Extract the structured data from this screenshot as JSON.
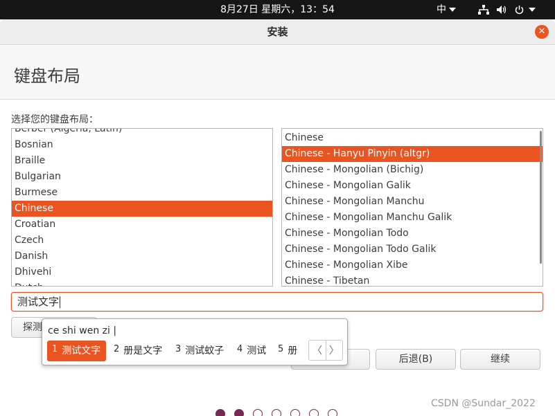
{
  "top_panel": {
    "clock": "8月27日 星期六，13：54",
    "input_indicator": "中"
  },
  "window": {
    "title": "安装",
    "close_symbol": "✕"
  },
  "page": {
    "title": "键盘布局",
    "select_label": "选择您的键盘布局："
  },
  "layouts": {
    "partial_top_item": "Berber (Algeria, Latin)",
    "items": [
      "Bosnian",
      "Braille",
      "Bulgarian",
      "Burmese",
      "Chinese",
      "Croatian",
      "Czech",
      "Danish",
      "Dhivehi"
    ],
    "partial_bottom_item": "Dutch",
    "selected": "Chinese"
  },
  "variants": {
    "items": [
      "Chinese",
      "Chinese - Hanyu Pinyin (altgr)",
      "Chinese - Mongolian (Bichig)",
      "Chinese - Mongolian Galik",
      "Chinese - Mongolian Manchu",
      "Chinese - Mongolian Manchu Galik",
      "Chinese - Mongolian Todo",
      "Chinese - Mongolian Todo Galik",
      "Chinese - Mongolian Xibe",
      "Chinese - Tibetan"
    ],
    "selected": "Chinese - Hanyu Pinyin (altgr)"
  },
  "test_input": {
    "value": "测试文字"
  },
  "buttons": {
    "detect": "探测",
    "back": "后退(B)",
    "next": "继续"
  },
  "ime": {
    "preedit": "ce shi wen zi |",
    "candidates": [
      {
        "num": "1",
        "text": "测试文字"
      },
      {
        "num": "2",
        "text": "册是文字"
      },
      {
        "num": "3",
        "text": "测试蚊子"
      },
      {
        "num": "4",
        "text": "测试"
      },
      {
        "num": "5",
        "text": "册"
      }
    ],
    "prev_symbol": "〈",
    "next_symbol": "〉"
  },
  "progress": {
    "total_steps": 7,
    "completed_steps": 2
  },
  "watermark": "CSDN @Sundar_2022",
  "colors": {
    "accent": "#e95420",
    "aubergine": "#772953",
    "panel": "#161616"
  },
  "icons": [
    "network-icon",
    "volume-icon",
    "power-icon"
  ]
}
